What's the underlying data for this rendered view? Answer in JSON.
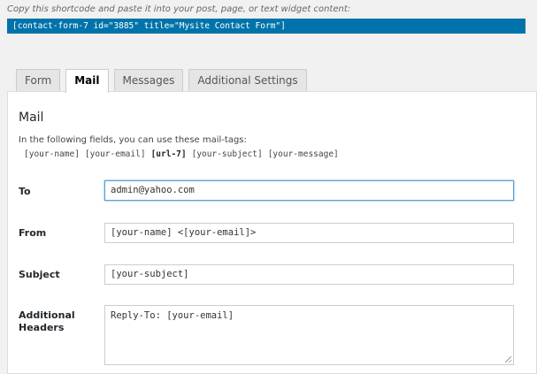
{
  "hint": "Copy this shortcode and paste it into your post, page, or text widget content:",
  "shortcode": "[contact-form-7 id=\"3885\" title=\"Mysite Contact Form\"]",
  "tabs": [
    {
      "label": "Form",
      "active": false
    },
    {
      "label": "Mail",
      "active": true
    },
    {
      "label": "Messages",
      "active": false
    },
    {
      "label": "Additional Settings",
      "active": false
    }
  ],
  "panel": {
    "title": "Mail",
    "description": "In the following fields, you can use these mail-tags:",
    "mail_tags": [
      "[your-name]",
      "[your-email]",
      "[url-7]",
      "[your-subject]",
      "[your-message]"
    ]
  },
  "fields": {
    "to": {
      "label": "To",
      "value": "admin@yahoo.com"
    },
    "from": {
      "label": "From",
      "value": "[your-name] <[your-email]>"
    },
    "subject": {
      "label": "Subject",
      "value": "[your-subject]"
    },
    "headers": {
      "label": "Additional Headers",
      "value": "Reply-To: [your-email]"
    }
  }
}
